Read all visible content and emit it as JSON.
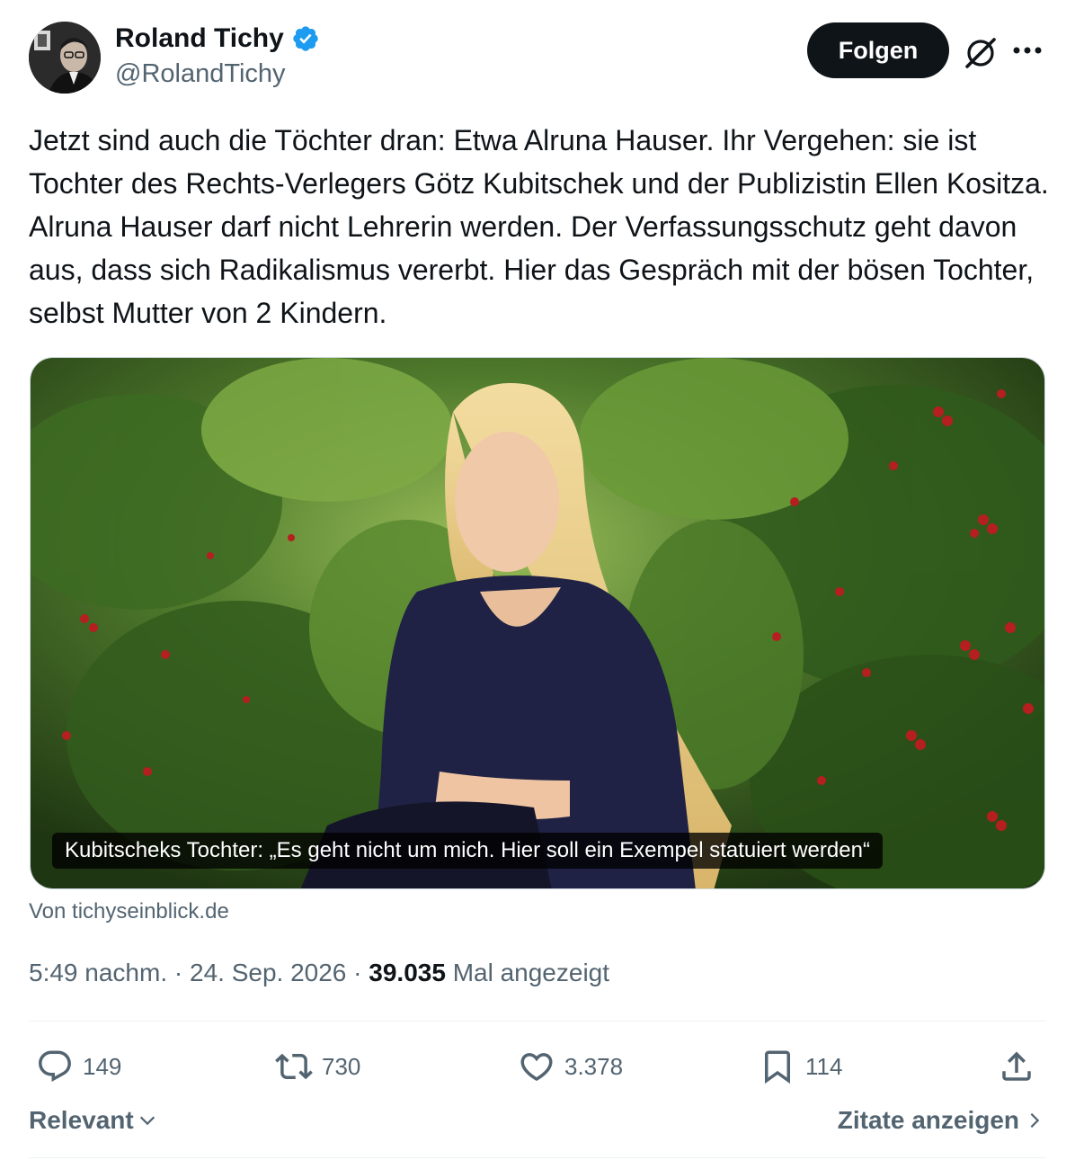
{
  "author": {
    "name": "Roland Tichy",
    "handle": "@RolandTichy"
  },
  "header": {
    "follow_label": "Folgen"
  },
  "tweet": {
    "text": "Jetzt sind auch die Töchter dran: Etwa Alruna Hauser. Ihr Vergehen: sie ist Tochter des Rechts-Verlegers Götz Kubitschek und der Publizistin Ellen Kositza. Alruna Hauser darf nicht Lehrerin werden. Der Verfassungsschutz geht davon aus, dass sich Radikalismus vererbt.  Hier das Gespräch mit der bösen Tochter, selbst Mutter von 2 Kindern."
  },
  "card": {
    "caption": "Kubitscheks Tochter: „Es geht nicht um mich. Hier soll ein Exempel statuiert werden“",
    "source": "Von tichyseinblick.de"
  },
  "meta": {
    "time": "5:49 nachm.",
    "separator": " · ",
    "date": "24. Sep. 2026",
    "views_count": "39.035",
    "views_label": "Mal angezeigt"
  },
  "actions": {
    "replies": "149",
    "reposts": "730",
    "likes": "3.378",
    "bookmarks": "114"
  },
  "footer": {
    "sort_label": "Relevant",
    "quotes_label": "Zitate anzeigen"
  },
  "colors": {
    "text_primary": "#0f1419",
    "text_secondary": "#536471",
    "verified_blue": "#1d9bf0",
    "button_dark": "#0f1419"
  }
}
